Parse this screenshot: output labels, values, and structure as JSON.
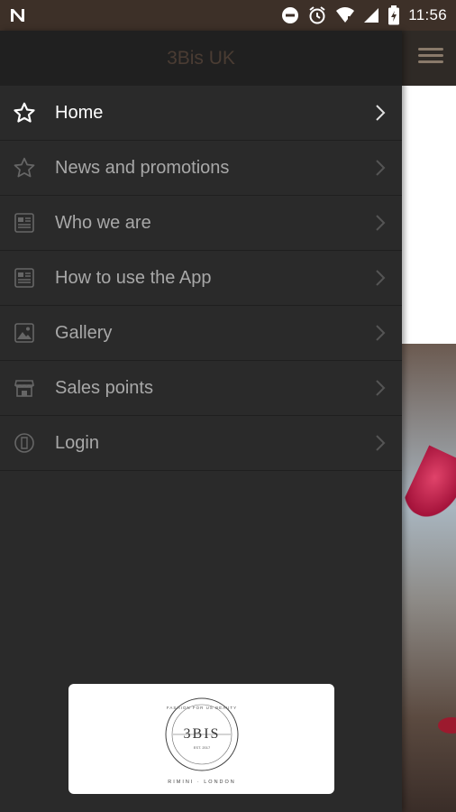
{
  "status_bar": {
    "time": "11:56",
    "icons": [
      "n-icon",
      "dnd-icon",
      "alarm-icon",
      "wifi-icon",
      "signal-icon",
      "battery-icon"
    ]
  },
  "drawer": {
    "title": "3Bis UK",
    "items": [
      {
        "label": "Home",
        "icon": "star-icon",
        "active": true
      },
      {
        "label": "News and promotions",
        "icon": "star-icon"
      },
      {
        "label": "Who we are",
        "icon": "document-icon"
      },
      {
        "label": "How to use the App",
        "icon": "document-icon"
      },
      {
        "label": "Gallery",
        "icon": "image-icon"
      },
      {
        "label": "Sales points",
        "icon": "store-icon"
      },
      {
        "label": "Login",
        "icon": "user-icon"
      }
    ],
    "logo": {
      "brand": "3BIS",
      "arc_top": "FASHION FOR US BEAUTY",
      "est": "EST. 2017",
      "bottom": "RIMINI · LONDON"
    }
  },
  "colors": {
    "status_bar": "#3d3028",
    "drawer_bg": "#2a2a2a",
    "drawer_header": "#202020",
    "accent_brown": "#4a3c33"
  }
}
